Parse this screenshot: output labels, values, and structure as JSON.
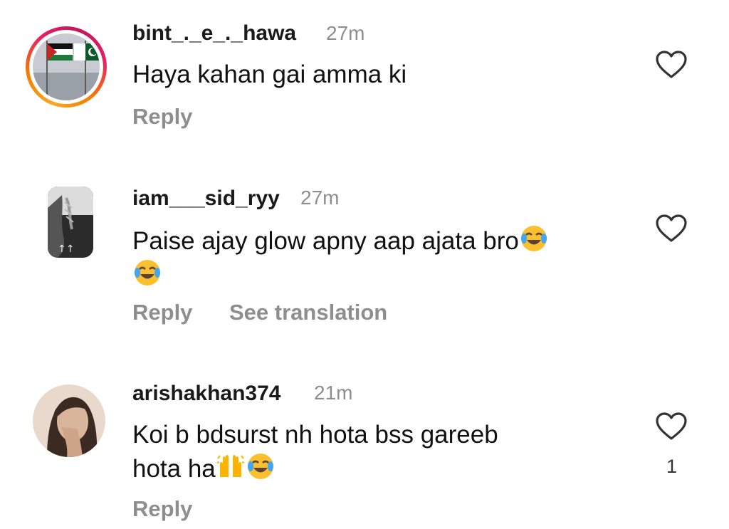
{
  "comments": [
    {
      "username": "bint_._e_._hawa",
      "time": "27m",
      "text": "Haya kahan gai amma ki",
      "reply_label": "Reply",
      "avatar": "flags-avatar",
      "has_story_ring": true
    },
    {
      "username": "iam___sid_ryy",
      "time": "27m",
      "text_line1": "Paise ajay glow apny aap ajata bro",
      "emoji_icon": "face-with-tears-of-joy-icon",
      "reply_label": "Reply",
      "translation_label": "See translation",
      "avatar": "monochrome-avatar"
    },
    {
      "username": "arishakhan374",
      "time": "21m",
      "text_line1": "Koi b bdsurst nh hota bss gareeb",
      "text_line2": "hota ha",
      "emoji_icons": [
        "raising-hands-icon",
        "face-with-tears-of-joy-icon"
      ],
      "like_count": "1",
      "reply_label": "Reply",
      "avatar": "portrait-avatar"
    }
  ],
  "icons": {
    "like": "heart-outline-icon"
  },
  "colors": {
    "secondary_text": "#8e8e8e",
    "story_ring": "#e91e63"
  }
}
